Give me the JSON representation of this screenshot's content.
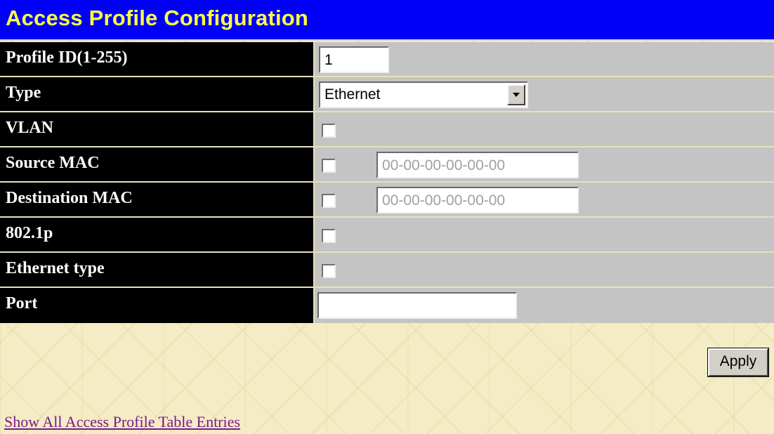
{
  "page": {
    "title": "Access Profile Configuration"
  },
  "form": {
    "profile_id": {
      "label": "Profile ID(1-255)",
      "value": "1"
    },
    "type": {
      "label": "Type",
      "selected": "Ethernet"
    },
    "vlan": {
      "label": "VLAN",
      "checked": false
    },
    "source_mac": {
      "label": "Source MAC",
      "checked": false,
      "mask_value": "00-00-00-00-00-00"
    },
    "destination_mac": {
      "label": "Destination MAC",
      "checked": false,
      "mask_value": "00-00-00-00-00-00"
    },
    "dot1p": {
      "label": "802.1p",
      "checked": false
    },
    "ethernet_type": {
      "label": "Ethernet type",
      "checked": false
    },
    "port": {
      "label": "Port",
      "value": ""
    }
  },
  "actions": {
    "apply_label": "Apply",
    "show_entries_link": "Show All Access Profile Table Entries"
  },
  "icons": {
    "select_arrow": "chevron-down-icon"
  },
  "colors": {
    "title_bar": "#0000f8",
    "title_text": "#ffff40",
    "label_bg": "#000000",
    "value_bg": "#c4c4c4",
    "link": "#7a1a8a"
  }
}
